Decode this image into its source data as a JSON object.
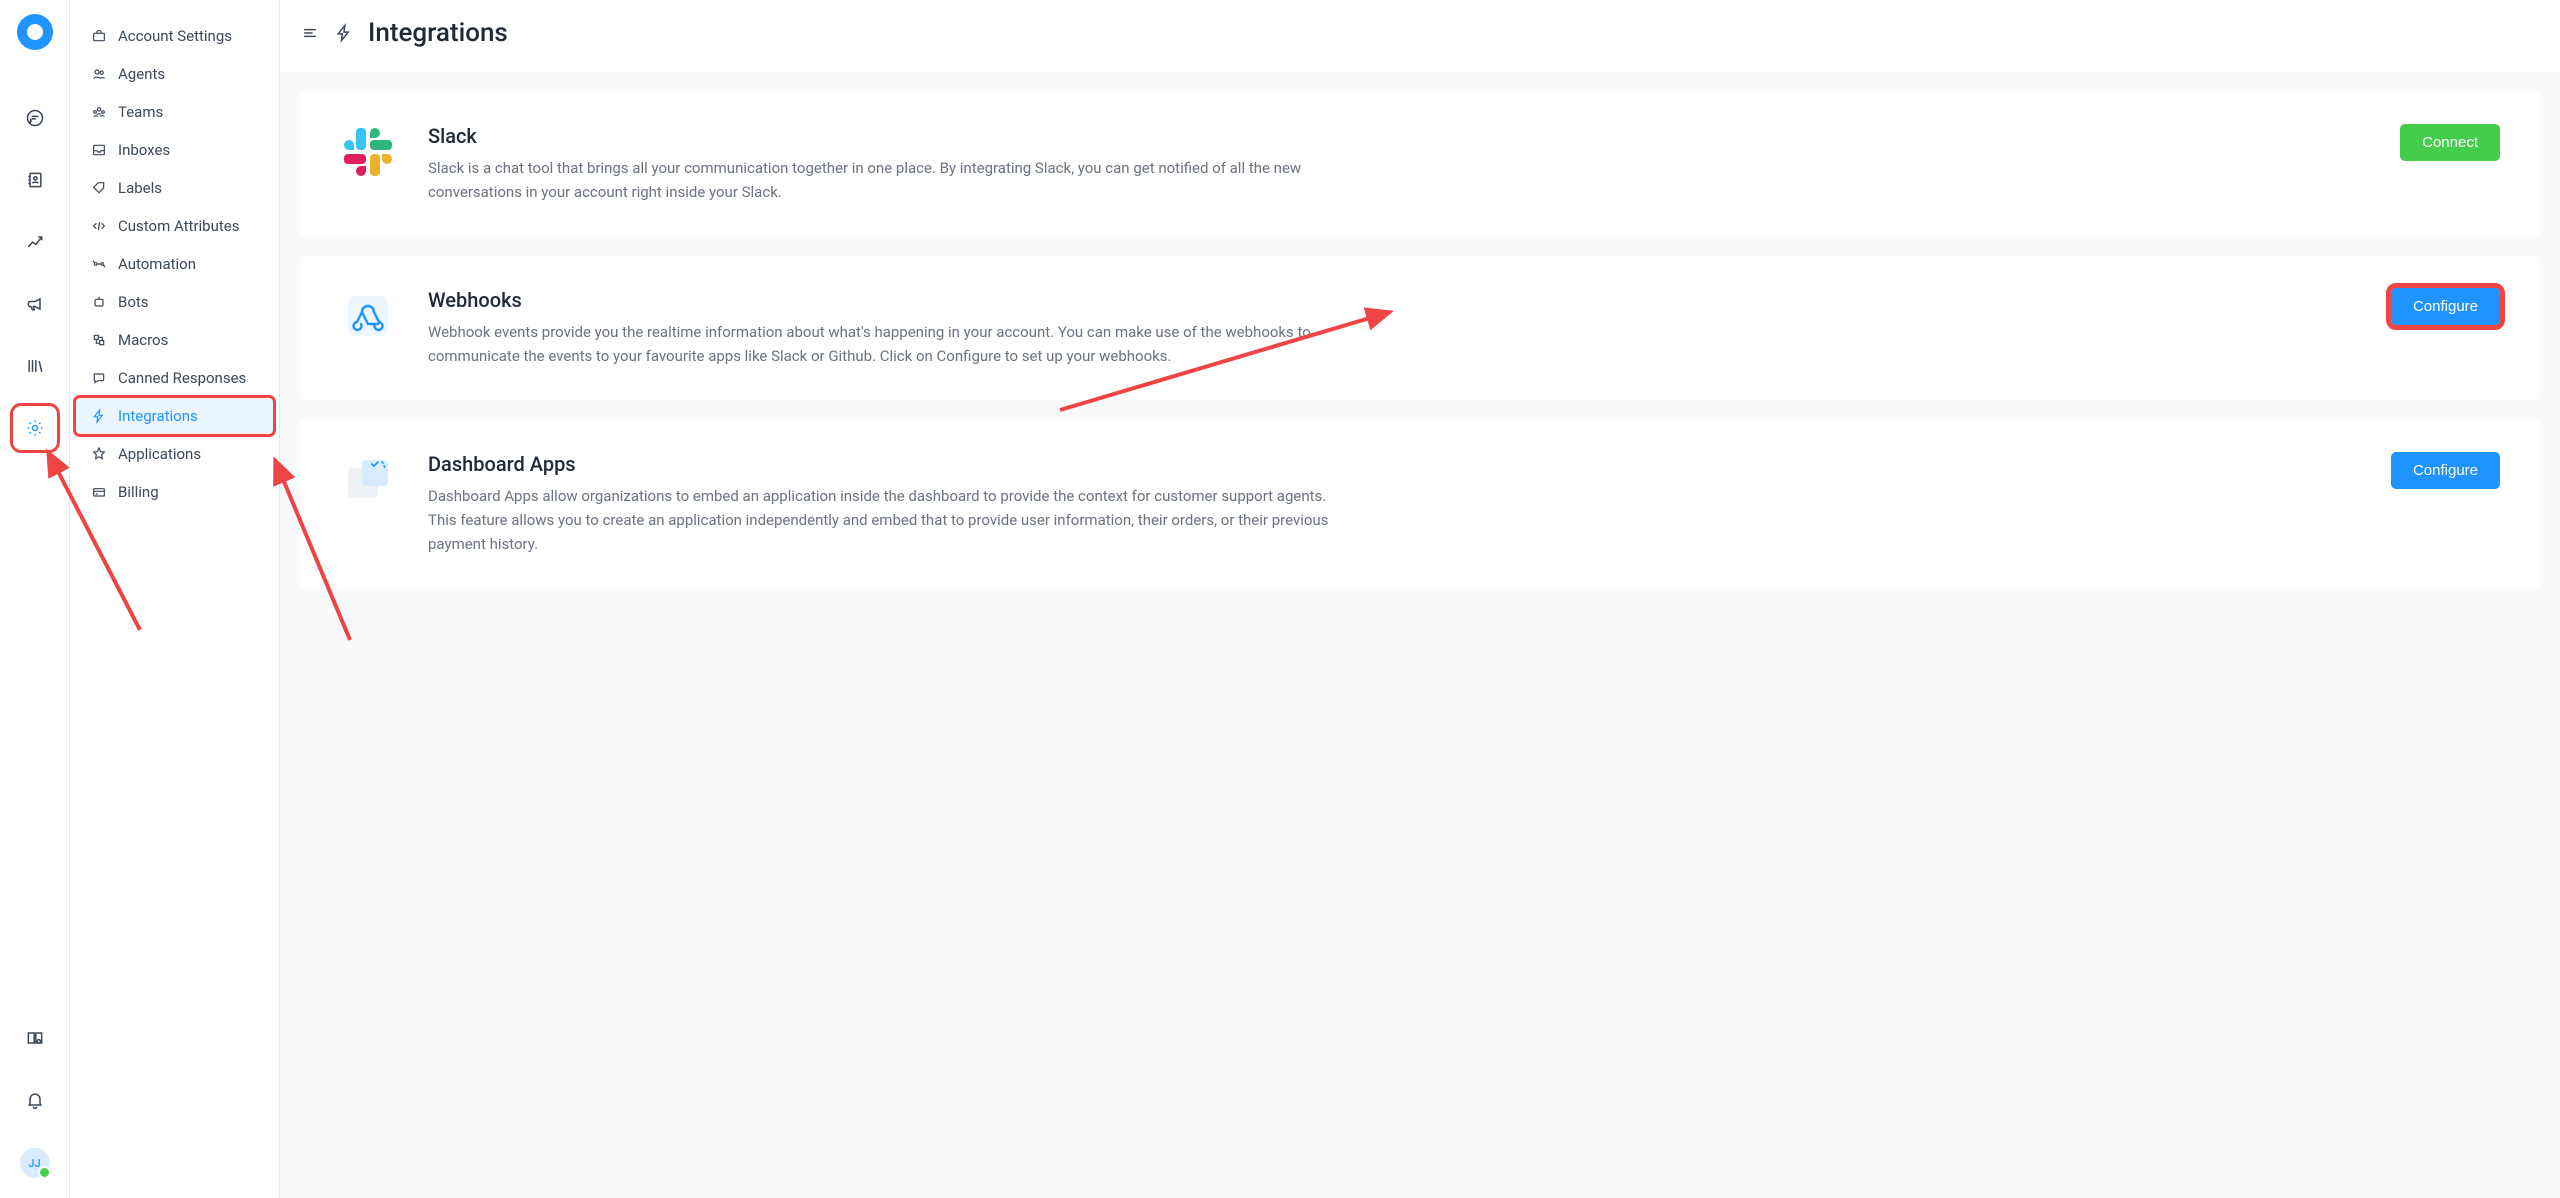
{
  "header": {
    "title": "Integrations"
  },
  "avatar": {
    "initials": "JJ"
  },
  "sidebar": {
    "items": [
      {
        "label": "Account Settings"
      },
      {
        "label": "Agents"
      },
      {
        "label": "Teams"
      },
      {
        "label": "Inboxes"
      },
      {
        "label": "Labels"
      },
      {
        "label": "Custom Attributes"
      },
      {
        "label": "Automation"
      },
      {
        "label": "Bots"
      },
      {
        "label": "Macros"
      },
      {
        "label": "Canned Responses"
      },
      {
        "label": "Integrations",
        "active": true
      },
      {
        "label": "Applications"
      },
      {
        "label": "Billing"
      }
    ]
  },
  "integrations": [
    {
      "key": "slack",
      "title": "Slack",
      "description": "Slack is a chat tool that brings all your communication together in one place. By integrating Slack, you can get notified of all the new conversations in your account right inside your Slack.",
      "button_label": "Connect",
      "button_style": "green"
    },
    {
      "key": "webhooks",
      "title": "Webhooks",
      "description": "Webhook events provide you the realtime information about what's happening in your account. You can make use of the webhooks to communicate the events to your favourite apps like Slack or Github. Click on Configure to set up your webhooks.",
      "button_label": "Configure",
      "button_style": "blue",
      "button_highlighted": true
    },
    {
      "key": "dashboard-apps",
      "title": "Dashboard Apps",
      "description": "Dashboard Apps allow organizations to embed an application inside the dashboard to provide the context for customer support agents. This feature allows you to create an application independently and embed that to provide user information, their orders, or their previous payment history.",
      "button_label": "Configure",
      "button_style": "blue"
    }
  ]
}
